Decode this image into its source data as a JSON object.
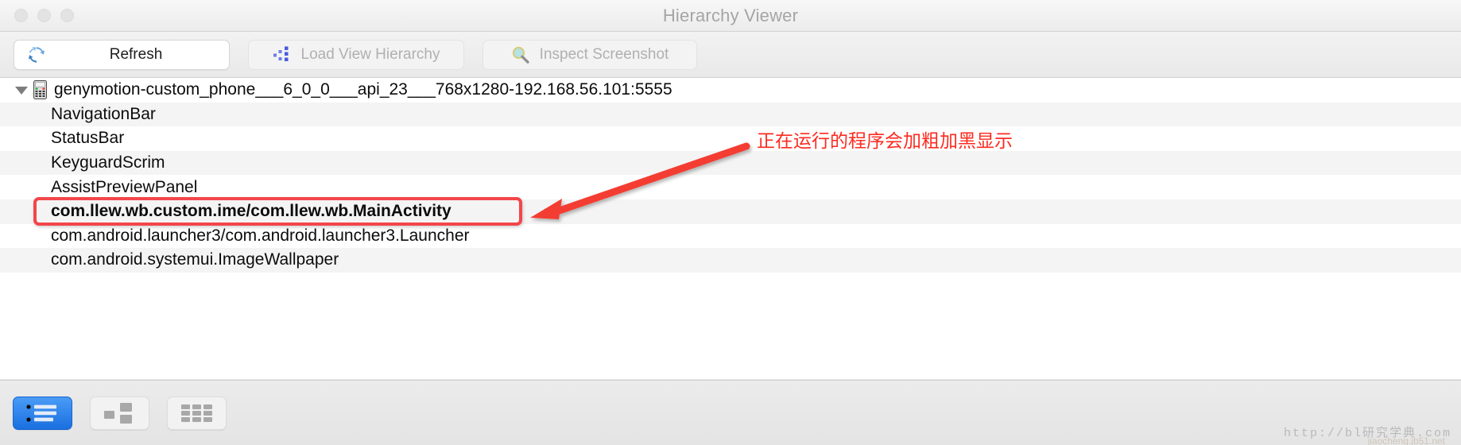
{
  "window": {
    "title": "Hierarchy Viewer",
    "traffic_lights": [
      "close",
      "minimize",
      "maximize"
    ]
  },
  "toolbar": {
    "refresh_label": "Refresh",
    "refresh_icon": "refresh-icon",
    "load_label": "Load View Hierarchy",
    "load_icon": "hierarchy-icon",
    "inspect_label": "Inspect Screenshot",
    "inspect_icon": "magnifier-icon"
  },
  "tree": {
    "root": {
      "label": "genymotion-custom_phone___6_0_0___api_23___768x1280-192.168.56.101:5555",
      "icon": "device-phone-icon",
      "expanded": true
    },
    "children": [
      {
        "label": "NavigationBar",
        "bold": false
      },
      {
        "label": "StatusBar",
        "bold": false
      },
      {
        "label": "KeyguardScrim",
        "bold": false
      },
      {
        "label": "AssistPreviewPanel",
        "bold": false
      },
      {
        "label": "com.llew.wb.custom.ime/com.llew.wb.MainActivity",
        "bold": true
      },
      {
        "label": "com.android.launcher3/com.android.launcher3.Launcher",
        "bold": false
      },
      {
        "label": "com.android.systemui.ImageWallpaper",
        "bold": false
      }
    ]
  },
  "annotation": {
    "text": "正在运行的程序会加粗加黑显示",
    "color": "#fb2b20",
    "highlight_color": "#f2464b"
  },
  "bottom_bar": {
    "modes": [
      {
        "name": "tree-view",
        "icon": "list-view-icon",
        "active": true
      },
      {
        "name": "block-view",
        "icon": "block-view-icon",
        "active": false
      },
      {
        "name": "grid-view",
        "icon": "grid-view-icon",
        "active": false
      }
    ],
    "watermark": "http://bl研究学典.com",
    "watermark_sub": "jiaocheng.jb51.net"
  }
}
